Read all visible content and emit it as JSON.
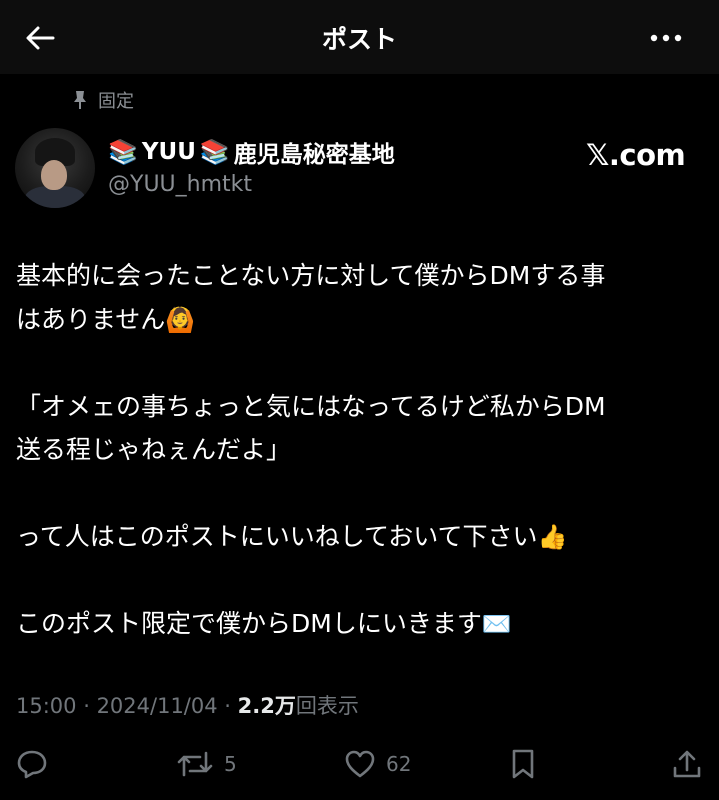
{
  "header": {
    "title": "ポスト",
    "back_icon": "arrow-left-icon",
    "more_icon": "more-horizontal-icon"
  },
  "pinned": {
    "label": "固定",
    "icon": "pin-icon"
  },
  "author": {
    "name_prefix_emoji": "📚",
    "name_main": "YUU",
    "name_mid_emoji": "📚",
    "name_suffix": "鹿児島秘密基地",
    "handle": "@YUU_hmtkt",
    "watermark": "𝕏.com"
  },
  "tweet": {
    "line1": "基本的に会ったことない方に対して僕からDMする事",
    "line2": "はありません",
    "line2_emoji": "🙆",
    "line3": "「オメェの事ちょっと気にはなってるけど私からDM",
    "line4": "送る程じゃねぇんだよ」",
    "line5": "って人はこのポストにいいねしておいて下さい",
    "line5_emoji": "👍",
    "line6": "このポスト限定で僕からDMしにいきます",
    "line6_emoji": "✉️"
  },
  "meta": {
    "time": "15:00",
    "separator1": " · ",
    "date": "2024/11/04",
    "separator2": " · ",
    "views_count": "2.2万",
    "views_label": "回表示"
  },
  "actions": {
    "reply_icon": "reply-icon",
    "retweet_icon": "retweet-icon",
    "retweet_count": "5",
    "like_icon": "heart-icon",
    "like_count": "62",
    "bookmark_icon": "bookmark-icon",
    "share_icon": "share-icon"
  },
  "colors": {
    "background": "#000000",
    "header_background": "#0d0d0d",
    "text_primary": "#ffffff",
    "text_secondary": "#71767b"
  }
}
